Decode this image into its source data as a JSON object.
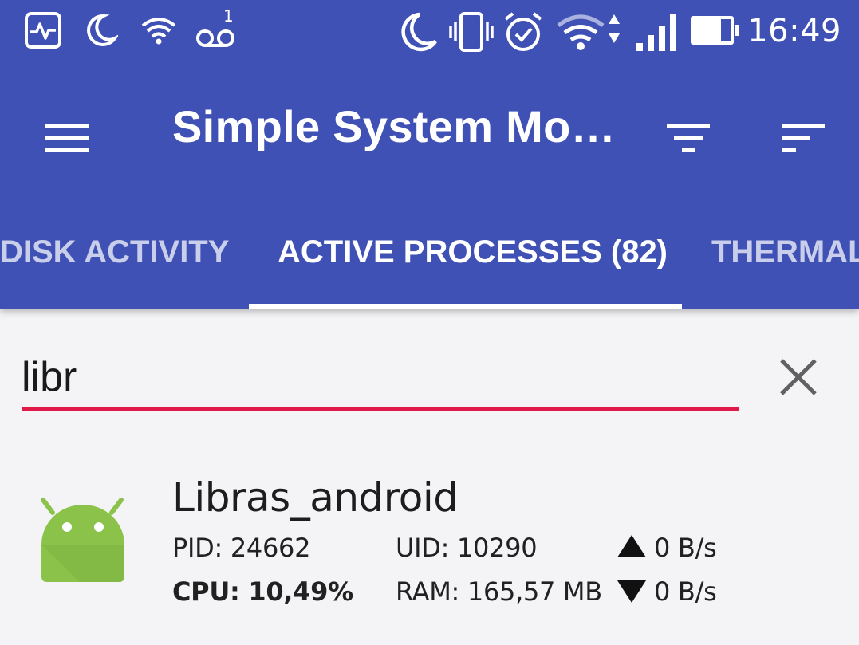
{
  "status_bar": {
    "time": "16:49",
    "voicemail_count": "1",
    "icons": [
      "activity-monitor-icon",
      "moon-icon",
      "wifi-icon",
      "voicemail-icon",
      "do-not-disturb-icon",
      "vibrate-icon",
      "alarm-icon",
      "wifi-data-icon",
      "signal-icon",
      "battery-icon"
    ]
  },
  "toolbar": {
    "title": "Simple System Mo…",
    "menu_icon": "hamburger-menu-icon",
    "filter_icon": "filter-icon",
    "sort_icon": "sort-icon"
  },
  "tabs": [
    {
      "label": "DISK ACTIVITY",
      "active": false
    },
    {
      "label": "ACTIVE PROCESSES (82)",
      "active": true
    },
    {
      "label": "THERMAL",
      "active": false
    }
  ],
  "search": {
    "value": "libr",
    "clear_icon": "close-icon"
  },
  "processes": [
    {
      "name": "Libras_android",
      "icon": "android-icon",
      "pid": "PID: 24662",
      "uid": "UID: 10290",
      "cpu": "CPU: 10,49%",
      "ram": "RAM: 165,57 MB",
      "upload": "0 B/s",
      "download": "0 B/s"
    }
  ],
  "colors": {
    "primary": "#3f51b5",
    "accent": "#e0194a",
    "android_green": "#8bc34a",
    "background": "#f4f3f6"
  }
}
